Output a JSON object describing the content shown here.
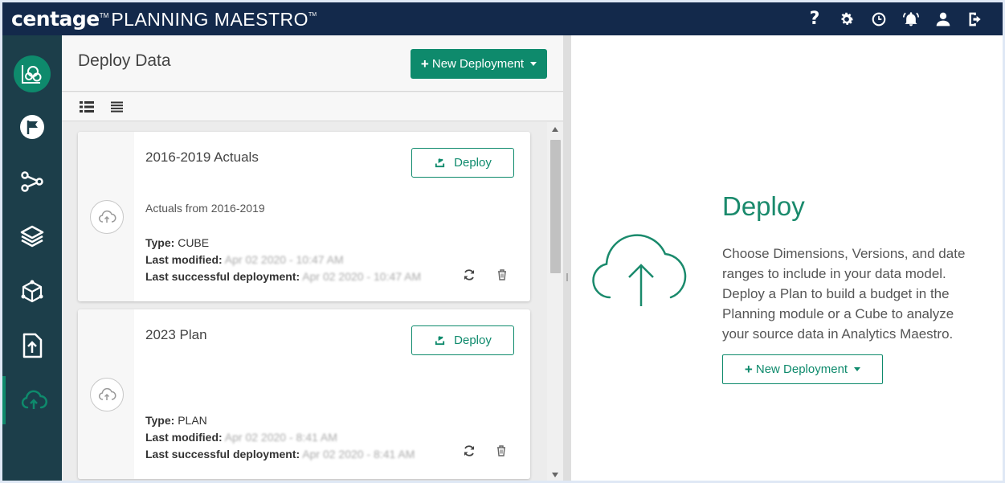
{
  "app": {
    "brand_logo": "centage",
    "brand_tm": "TM",
    "brand_name": "PLANNING MAESTRO",
    "brand_name_tm": "TM"
  },
  "topbar": {
    "icons": [
      "help-icon",
      "settings-icon",
      "history-icon",
      "alerts-icon",
      "user-icon",
      "logout-icon"
    ],
    "help_glyph": "?"
  },
  "sidebar": {
    "items": [
      {
        "icon": "model-logo-icon"
      },
      {
        "icon": "flag-icon"
      },
      {
        "icon": "workflow-icon"
      },
      {
        "icon": "layers-icon"
      },
      {
        "icon": "cube-icon"
      },
      {
        "icon": "upload-file-icon"
      },
      {
        "icon": "cloud-upload-icon",
        "active": true
      }
    ]
  },
  "left_panel": {
    "title": "Deploy Data",
    "new_deployment_label": "New Deployment",
    "plus_glyph": "+"
  },
  "cards": [
    {
      "title": "2016-2019 Actuals",
      "description": "Actuals from 2016-2019",
      "deploy_label": "Deploy",
      "type_label": "Type:",
      "type_value": "CUBE",
      "modified_label": "Last modified:",
      "modified_value": "Apr 02 2020 - 10:47 AM",
      "success_label": "Last successful deployment:",
      "success_value": "Apr 02 2020 - 10:47 AM"
    },
    {
      "title": "2023 Plan",
      "description": "",
      "deploy_label": "Deploy",
      "type_label": "Type:",
      "type_value": "PLAN",
      "modified_label": "Last modified:",
      "modified_value": "Apr 02 2020 - 8:41 AM",
      "success_label": "Last successful deployment:",
      "success_value": "Apr 02 2020 - 8:41 AM"
    }
  ],
  "right_panel": {
    "title": "Deploy",
    "description": "Choose Dimensions, Versions, and date ranges to include in your data model. Deploy a Plan to build a budget in the Planning module or a Cube to analyze your source data in Analytics Maestro.",
    "new_deployment_label": "New Deployment",
    "plus_glyph": "+"
  },
  "colors": {
    "topbar": "#13294b",
    "sidebar": "#1c3e4a",
    "accent": "#0e8a6c"
  }
}
